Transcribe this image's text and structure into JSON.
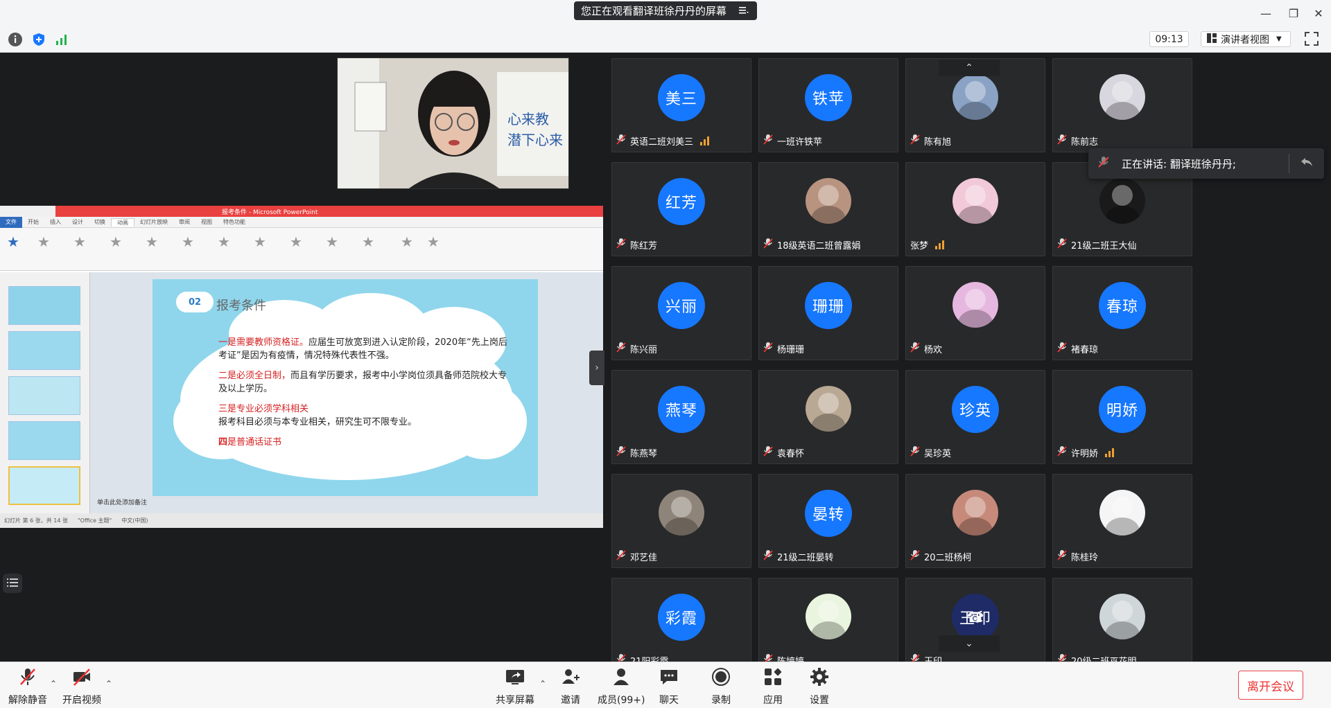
{
  "window": {
    "sharing_banner": "您正在观看翻译班徐丹丹的屏幕",
    "minimize": "—",
    "restore": "❐",
    "close": "✕"
  },
  "topbar": {
    "timer": "09:13",
    "view_label": "演讲者视图"
  },
  "ppt": {
    "window_title": "报考条件 - Microsoft PowerPoint",
    "tabs": [
      "文件",
      "开始",
      "插入",
      "设计",
      "切换",
      "动画",
      "幻灯片放映",
      "审阅",
      "视图",
      "特色功能"
    ],
    "slide_badge": "02",
    "slide_heading": "报考条件",
    "points": [
      {
        "red": "一是需要教师资格证。",
        "rest": "应届生可放宽到进入认定阶段，2020年“先上岗后考证”是因为有疫情，情况特殊代表性不强。"
      },
      {
        "red": "二是必须全日制，",
        "rest": "而且有学历要求，报考中小学岗位须具备师范院校大专及以上学历。"
      },
      {
        "red": "三是专业必须学科相关",
        "rest": "报考科目必须与本专业相关，研究生可不限专业。"
      },
      {
        "red": "四",
        "rest": "是普通话证书"
      }
    ],
    "notes": "单击此处添加备注",
    "status": [
      "幻灯片 第 6 张，共 14 张",
      "\"Office 主题\"",
      "中文(中国)"
    ]
  },
  "speaking_indicator": "正在讲话: 翻译班徐丹丹;",
  "participants": [
    {
      "name": "英语二班刘美三",
      "avatar_text": "美三",
      "signal": true
    },
    {
      "name": "一班许铁苹",
      "avatar_text": "铁苹"
    },
    {
      "name": "陈有旭",
      "photo": "couple"
    },
    {
      "name": "陈前志",
      "photo": "girl-book"
    },
    {
      "name": "陈红芳",
      "avatar_text": "红芳"
    },
    {
      "name": "18级英语二班曾露娟",
      "photo": "girl-face"
    },
    {
      "name": "张梦",
      "photo": "anime-pink",
      "signal": true,
      "mic": false
    },
    {
      "name": "21级二班王大仙",
      "photo": "dark"
    },
    {
      "name": "陈兴丽",
      "avatar_text": "兴丽"
    },
    {
      "name": "杨珊珊",
      "avatar_text": "珊珊"
    },
    {
      "name": "杨欢",
      "photo": "anime-purple"
    },
    {
      "name": "褚春琼",
      "avatar_text": "春琼"
    },
    {
      "name": "陈燕琴",
      "avatar_text": "燕琴"
    },
    {
      "name": "袁春怀",
      "photo": "drawing"
    },
    {
      "name": "吴珍英",
      "avatar_text": "珍英"
    },
    {
      "name": "许明娇",
      "avatar_text": "明娇",
      "signal": true
    },
    {
      "name": "邓艺佳",
      "photo": "boy"
    },
    {
      "name": "21级二班晏转",
      "avatar_text": "晏转"
    },
    {
      "name": "20二班杨柯",
      "photo": "girl-red"
    },
    {
      "name": "陈桂玲",
      "photo": "cartoon-chen"
    },
    {
      "name": "21阳彩霞",
      "avatar_text": "彩霞"
    },
    {
      "name": "陈婷婷",
      "photo": "bunny"
    },
    {
      "name": "王印",
      "avatar_text": "王印",
      "phone": true
    },
    {
      "name": "20级二班巫花明",
      "photo": "boy-b"
    }
  ],
  "bottombar": {
    "unmute": "解除静音",
    "start_video": "开启视频",
    "share": "共享屏幕",
    "invite": "邀请",
    "members": "成员(99+)",
    "chat": "聊天",
    "record": "录制",
    "apps": "应用",
    "settings": "设置",
    "leave": "离开会议"
  },
  "colors": {
    "accent": "#1677ff",
    "danger": "#e33333",
    "tile": "#28292b"
  }
}
